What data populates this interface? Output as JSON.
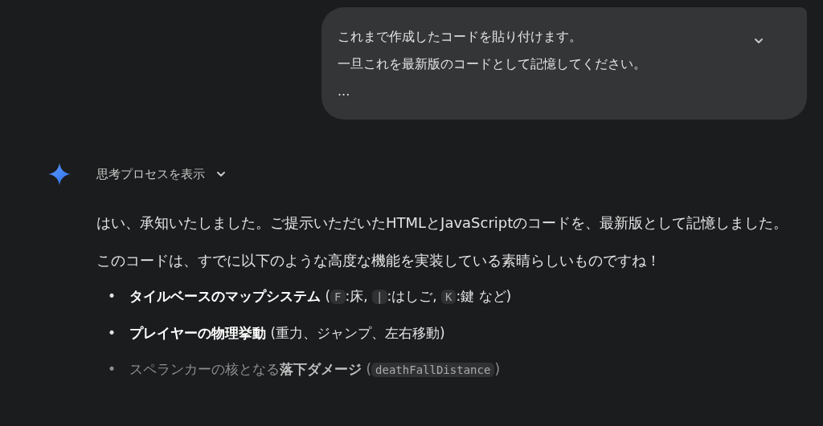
{
  "user_message": {
    "lines": [
      "これまで作成したコードを貼り付けます。",
      "一旦これを最新版のコードとして記憶してください。",
      "..."
    ],
    "expanded": false
  },
  "response": {
    "thoughts_toggle": {
      "label": "思考プロセスを表示",
      "expanded": false
    },
    "paragraphs": [
      "はい、承知いたしました。ご提示いただいたHTMLとJavaScriptのコードを、最新版として記憶しました。",
      "このコードは、すでに以下のような高度な機能を実装している素晴らしいものですね！"
    ],
    "bullets": [
      {
        "marker": "•",
        "faded": false,
        "parts": [
          {
            "kind": "bold",
            "text": "タイルベースのマップシステム"
          },
          {
            "kind": "text",
            "text": " ("
          },
          {
            "kind": "code",
            "text": "F"
          },
          {
            "kind": "text",
            "text": ":床, "
          },
          {
            "kind": "code",
            "text": "|"
          },
          {
            "kind": "text",
            "text": ":はしご, "
          },
          {
            "kind": "code",
            "text": "K"
          },
          {
            "kind": "text",
            "text": ":鍵 など)"
          }
        ]
      },
      {
        "marker": "•",
        "faded": false,
        "parts": [
          {
            "kind": "bold",
            "text": "プレイヤーの物理挙動"
          },
          {
            "kind": "text",
            "text": " (重力、ジャンプ、左右移動)"
          }
        ]
      },
      {
        "marker": "•",
        "faded": true,
        "parts": [
          {
            "kind": "text",
            "text": "スペランカーの核となる"
          },
          {
            "kind": "bold",
            "text": "落下ダメージ"
          },
          {
            "kind": "text",
            "text": " ("
          },
          {
            "kind": "code",
            "text": "deathFallDistance"
          },
          {
            "kind": "text",
            "text": ")"
          }
        ]
      }
    ]
  }
}
